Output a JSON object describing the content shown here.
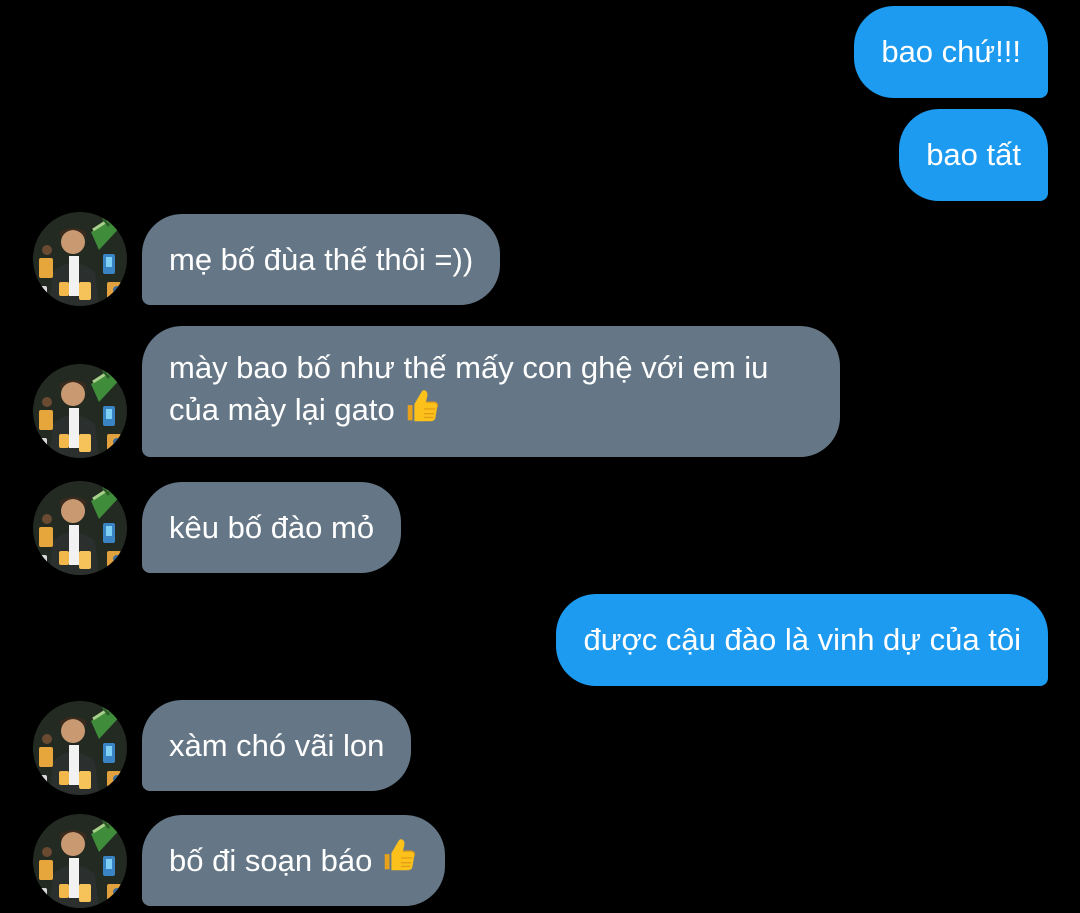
{
  "conversation": {
    "messages": [
      {
        "direction": "outgoing",
        "text": "bao chứ!!!"
      },
      {
        "direction": "outgoing",
        "text": "bao tất"
      },
      {
        "direction": "incoming",
        "text": "mẹ bố đùa thế thôi =))"
      },
      {
        "direction": "incoming",
        "text_line1": "mày bao bố như thế mấy con ghệ với em iu",
        "text_line2": "của mày lại gato",
        "emoji": "thumbs-up"
      },
      {
        "direction": "incoming",
        "text": "kêu bố đào mỏ"
      },
      {
        "direction": "outgoing",
        "text": "được cậu đào là vinh dự của tôi"
      },
      {
        "direction": "incoming",
        "text": "xàm chó vãi lon"
      },
      {
        "direction": "incoming",
        "text": "bố đi soạn báo",
        "emoji": "thumbs-up"
      }
    ]
  },
  "colors": {
    "background": "#000000",
    "outgoing_bubble": "#1d9bf0",
    "incoming_bubble": "#657786",
    "text": "#ffffff"
  }
}
